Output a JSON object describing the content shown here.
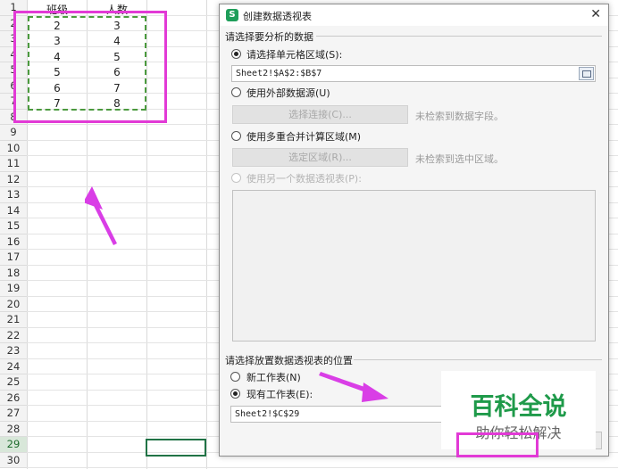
{
  "sheet": {
    "row_numbers": [
      "1",
      "2",
      "3",
      "4",
      "5",
      "6",
      "7",
      "8",
      "9",
      "10",
      "11",
      "12",
      "13",
      "14",
      "15",
      "16",
      "17",
      "18",
      "19",
      "20",
      "21",
      "22",
      "23",
      "24",
      "25",
      "26",
      "27",
      "28",
      "29",
      "30"
    ],
    "selected_row": "29",
    "header_col_a": "班级",
    "header_col_b": "人数",
    "rows": [
      {
        "a": "2",
        "b": "3"
      },
      {
        "a": "3",
        "b": "4"
      },
      {
        "a": "4",
        "b": "5"
      },
      {
        "a": "5",
        "b": "6"
      },
      {
        "a": "6",
        "b": "7"
      },
      {
        "a": "7",
        "b": "8"
      }
    ]
  },
  "dialog": {
    "title": "创建数据透视表",
    "app_icon": "S",
    "close_glyph": "✕",
    "section_data": "请选择要分析的数据",
    "opt_range": "请选择单元格区域(S):",
    "range_value": "Sheet2!$A$2:$B$7",
    "opt_external": "使用外部数据源(U)",
    "btn_select_connection": "选择连接(C)...",
    "note_no_fields": "未检索到数据字段。",
    "opt_multi": "使用多重合并计算区域(M)",
    "btn_select_region": "选定区域(R)...",
    "note_no_region": "未检索到选中区域。",
    "opt_other_pivot": "使用另一个数据透视表(P):",
    "section_place": "请选择放置数据透视表的位置",
    "opt_new_sheet": "新工作表(N)",
    "opt_existing_sheet": "现有工作表(E):",
    "place_value": "Sheet2!$C$29"
  },
  "watermark": {
    "big": "百科全说",
    "small": "助你轻松解决"
  },
  "colors": {
    "highlight": "#e23ad6",
    "arrow": "#d93ee6",
    "dashed_range": "#4b9a3e",
    "watermark": "#1f9a4a"
  }
}
